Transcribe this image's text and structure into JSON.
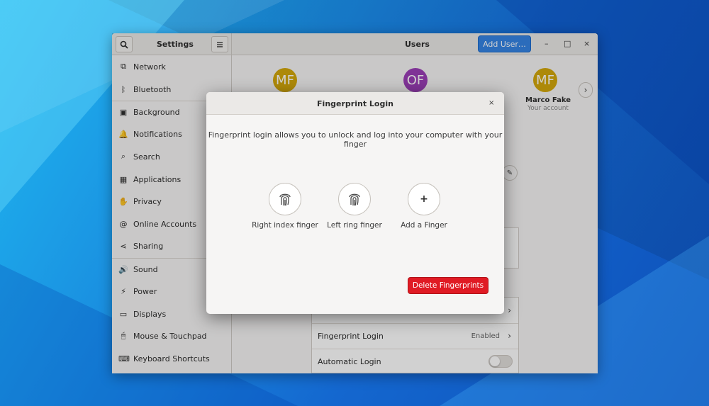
{
  "window": {
    "title_left": "Settings",
    "title_center": "Users",
    "add_user_label": "Add User…",
    "minimize": "–",
    "maximize": "□",
    "close": "×",
    "search_icon": "search-icon",
    "menu_icon": "hamburger-menu-icon"
  },
  "sidebar": {
    "items": [
      {
        "label": "Network",
        "icon": "network-icon",
        "glyph": "⧉"
      },
      {
        "label": "Bluetooth",
        "icon": "bluetooth-icon",
        "glyph": "ᛒ"
      },
      {
        "label": "Background",
        "icon": "background-icon",
        "glyph": "▣"
      },
      {
        "label": "Notifications",
        "icon": "bell-icon",
        "glyph": "🔔"
      },
      {
        "label": "Search",
        "icon": "search-icon",
        "glyph": "⌕"
      },
      {
        "label": "Applications",
        "icon": "applications-icon",
        "glyph": "▦"
      },
      {
        "label": "Privacy",
        "icon": "hand-icon",
        "glyph": "✋"
      },
      {
        "label": "Online Accounts",
        "icon": "at-icon",
        "glyph": "@"
      },
      {
        "label": "Sharing",
        "icon": "share-icon",
        "glyph": "⋖"
      },
      {
        "label": "Sound",
        "icon": "speaker-icon",
        "glyph": "🔊"
      },
      {
        "label": "Power",
        "icon": "power-icon",
        "glyph": "⚡"
      },
      {
        "label": "Displays",
        "icon": "display-icon",
        "glyph": "▭"
      },
      {
        "label": "Mouse & Touchpad",
        "icon": "mouse-icon",
        "glyph": "🖱"
      },
      {
        "label": "Keyboard Shortcuts",
        "icon": "keyboard-icon",
        "glyph": "⌨"
      }
    ]
  },
  "users": {
    "avatars": [
      {
        "initials": "MF",
        "color": "#d4a80c"
      },
      {
        "initials": "OF",
        "color": "#9c3fb7"
      },
      {
        "initials": "MF",
        "color": "#d4a80c"
      }
    ],
    "selected_name": "Marco Fake",
    "selected_subtitle": "Your account",
    "next_icon": "chevron-right-icon"
  },
  "settings_rows": {
    "fingerprint_label": "Fingerprint Login",
    "fingerprint_value": "Enabled",
    "automatic_login_label": "Automatic Login"
  },
  "dialog": {
    "title": "Fingerprint Login",
    "close": "×",
    "description": "Fingerprint login allows you to unlock and log into your computer with your finger",
    "fingers": [
      {
        "label": "Right index finger",
        "icon": "fingerprint-icon"
      },
      {
        "label": "Left ring finger",
        "icon": "fingerprint-icon"
      },
      {
        "label": "Add a Finger",
        "icon": "plus-icon"
      }
    ],
    "plus_glyph": "+",
    "delete_label": "Delete Fingerprints"
  },
  "colors": {
    "accent": "#3584e4",
    "destructive": "#e01b24"
  }
}
